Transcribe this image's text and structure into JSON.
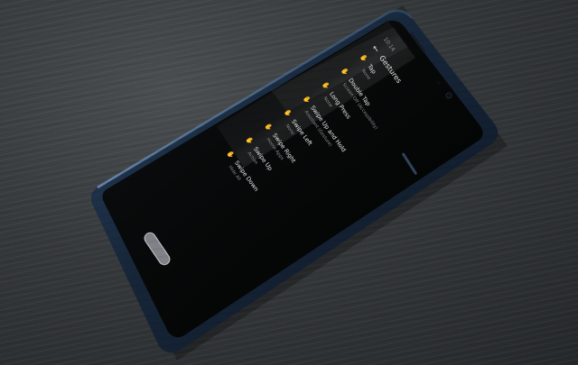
{
  "app": {
    "title": "Gestures",
    "status_time": "10:14"
  },
  "gestures": {
    "items": [
      {
        "name": "Tap",
        "value": "None"
      },
      {
        "name": "Double Tap",
        "value": "Screen Off (Accessibility)"
      },
      {
        "name": "Long Press",
        "value": "None"
      },
      {
        "name": "Swipe Up and Hold",
        "value": "Assistant (Gesture)"
      },
      {
        "name": "Swipe Left",
        "value": "None"
      },
      {
        "name": "Swipe Right",
        "value": "Home Apps"
      },
      {
        "name": "Swipe Up",
        "value": "Action"
      },
      {
        "name": "Swipe Down",
        "value": "Hide All"
      }
    ]
  },
  "colors": {
    "screen": "#050606",
    "text": "#e9e9e9",
    "subtext": "#8e8e8e",
    "accent": "#ff5252",
    "phone_frame": "#1c2b3e"
  },
  "icons": {
    "back": "arrow-left-icon",
    "gesture": "hand-gesture-icon"
  }
}
